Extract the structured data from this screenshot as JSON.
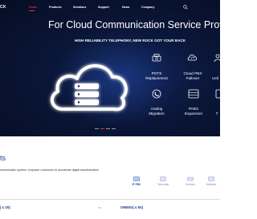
{
  "header": {
    "logo_text": "CK",
    "nav": [
      {
        "label": "Home",
        "active": true
      },
      {
        "label": "Products",
        "active": false
      },
      {
        "label": "Solutions",
        "active": false
      },
      {
        "label": "Support",
        "active": false
      },
      {
        "label": "News",
        "active": false
      },
      {
        "label": "Company",
        "active": false
      }
    ],
    "search_icon": "search-icon"
  },
  "hero": {
    "title": "For Cloud Communication Service Provi",
    "subtitle": "HIGH RELIABILITY TELEPHONY, NEW ROCK GOT YOUR BACK",
    "features": [
      {
        "line1": "POTS",
        "line2": "Replacement",
        "icon": "telephone-icon"
      },
      {
        "line1": "Cloud PBX",
        "line2": "Failover",
        "icon": "cloud-sync-icon"
      },
      {
        "line1": "",
        "line2": "Ucli",
        "icon": "user-icon"
      },
      {
        "line1": "Analog",
        "line2": "Migration",
        "icon": "analog-phone-icon"
      },
      {
        "line1": "PABX",
        "line2": "Expansion",
        "icon": "pabx-icon"
      },
      {
        "line1": "",
        "line2": "T",
        "icon": "device-icon"
      }
    ],
    "carousel": {
      "count": 4,
      "active_index": 1
    },
    "colors": {
      "accent": "#e8283a",
      "background": "#0a1638",
      "cloud": "#ffffff"
    }
  },
  "section": {
    "title": "ts",
    "description": "mmunication system, empower customers to accelerate digital transformation",
    "tabs": [
      {
        "label": "IP PBX",
        "icon": "ip-pbx-icon",
        "active": true
      },
      {
        "label": "Terminals",
        "icon": "terminals-icon",
        "active": false
      },
      {
        "label": "Devices",
        "icon": "devices-icon",
        "active": false
      },
      {
        "label": "Software",
        "icon": "software-icon",
        "active": false
      }
    ],
    "models": [
      {
        "label": "( ≤ 20)"
      },
      {
        "label": "OM50G( ≤ 50)"
      }
    ],
    "colors": {
      "title": "#1a3a8c",
      "active_tab": "#1a4bb5"
    }
  }
}
